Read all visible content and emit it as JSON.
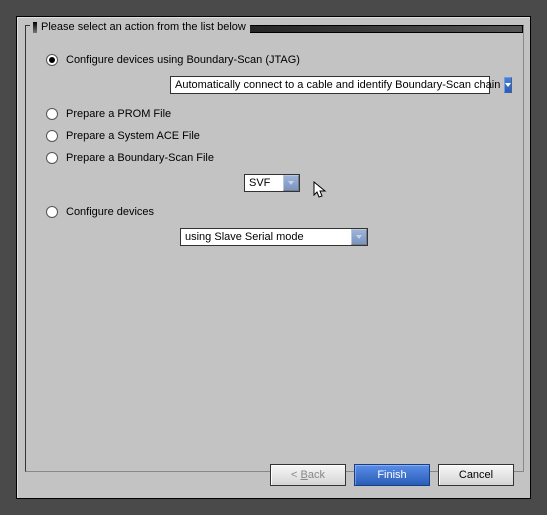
{
  "group_title": "Please select an action from the list below",
  "options": {
    "opt1_label": "Configure devices using Boundary-Scan (JTAG)",
    "opt1_combo": "Automatically connect to a cable and identify Boundary-Scan chain",
    "opt2_label": "Prepare a PROM File",
    "opt3_label": "Prepare a System ACE File",
    "opt4_label": "Prepare a Boundary-Scan File",
    "opt4_combo": "SVF",
    "opt5_label": "Configure devices",
    "opt5_combo": "using Slave Serial mode"
  },
  "buttons": {
    "back": "< Back",
    "finish": "Finish",
    "cancel": "Cancel"
  }
}
